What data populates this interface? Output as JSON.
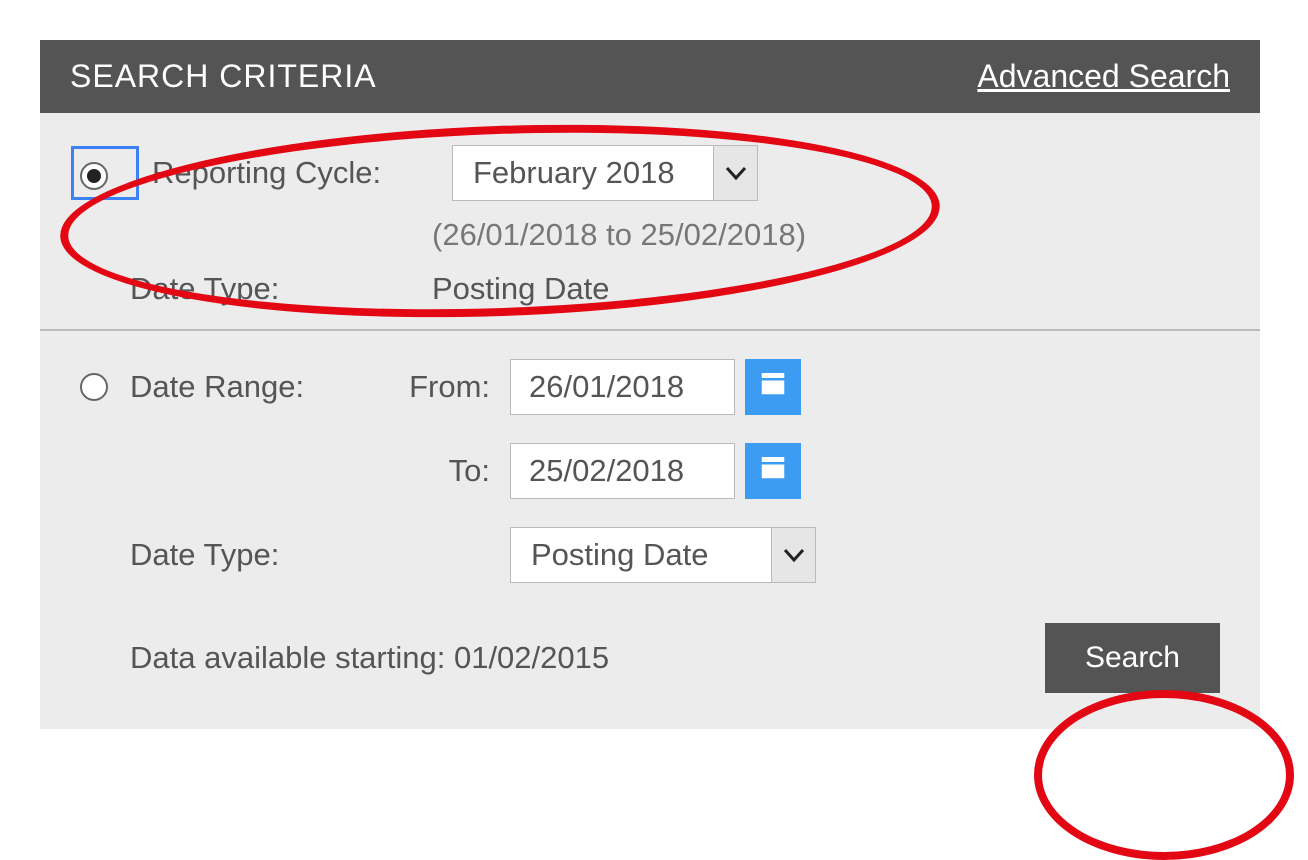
{
  "header": {
    "title": "SEARCH CRITERIA",
    "advanced_link": "Advanced Search"
  },
  "reportingCycle": {
    "radio_selected": true,
    "label": "Reporting Cycle:",
    "select_value": "February 2018",
    "range_hint": "(26/01/2018 to 25/02/2018)",
    "date_type_label": "Date Type:",
    "date_type_value": "Posting Date"
  },
  "dateRange": {
    "radio_selected": false,
    "label": "Date Range:",
    "from_label": "From:",
    "from_value": "26/01/2018",
    "to_label": "To:",
    "to_value": "25/02/2018",
    "date_type_label": "Date Type:",
    "date_type_select": "Posting Date"
  },
  "footer": {
    "data_available": "Data available starting: 01/02/2015",
    "search_button": "Search"
  }
}
